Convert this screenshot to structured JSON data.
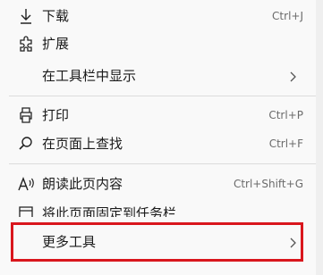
{
  "menu": {
    "items": [
      {
        "icon": "download-icon",
        "label": "下载",
        "shortcut": "Ctrl+J",
        "submenu": false
      },
      {
        "icon": "extensions-icon",
        "label": "扩展",
        "shortcut": "",
        "submenu": false
      },
      {
        "icon": "",
        "label": "在工具栏中显示",
        "shortcut": "",
        "submenu": true
      },
      {
        "icon": "print-icon",
        "label": "打印",
        "shortcut": "Ctrl+P",
        "submenu": false
      },
      {
        "icon": "find-icon",
        "label": "在页面上查找",
        "shortcut": "Ctrl+F",
        "submenu": false
      },
      {
        "icon": "read-aloud-icon",
        "label": "朗读此页内容",
        "shortcut": "Ctrl+Shift+G",
        "submenu": false
      },
      {
        "icon": "pin-icon",
        "label": "将此页面固定到任务栏",
        "shortcut": "",
        "submenu": false
      },
      {
        "icon": "",
        "label": "更多工具",
        "shortcut": "",
        "submenu": true
      }
    ]
  },
  "colors": {
    "background": "#f9f9f9",
    "text": "#1a1a1a",
    "shortcut": "#6b6b6b",
    "divider": "#dcdcdc",
    "highlight_border": "#d9161d"
  }
}
